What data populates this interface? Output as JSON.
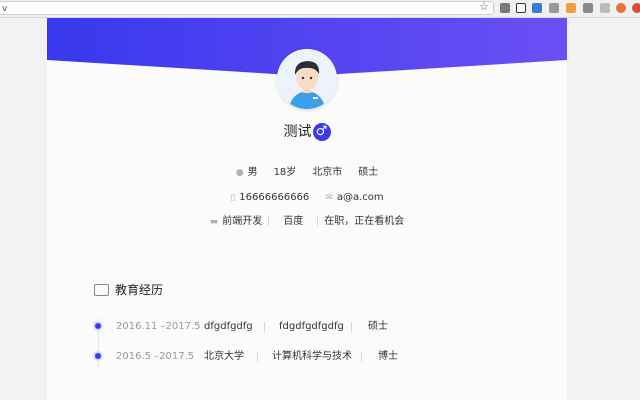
{
  "browser": {
    "url_fragment": "v",
    "colors": {
      "ext_gray": "#7a7a7a",
      "ext_blue": "#3b7bd6",
      "ext_orange": "#f0a040",
      "ext_red": "#e04a3a"
    }
  },
  "theme": {
    "accent": "#3b3be8",
    "header_gradient_start": "#3a3af0",
    "header_gradient_end": "#6a4ff5"
  },
  "profile": {
    "name": "测试",
    "gender_symbol": "♂",
    "gender": "男",
    "age": "18岁",
    "city": "北京市",
    "degree": "硕士",
    "phone": "16666666666",
    "email": "a@a.com",
    "job_title": "前端开发",
    "company": "百度",
    "status": "在职，正在看机会"
  },
  "education": {
    "title": "教育经历",
    "items": [
      {
        "date": "2016.11 –2017.5",
        "school": "dfgdfgdfg",
        "major": "fdgdfgdfgdfg",
        "degree": "硕士"
      },
      {
        "date": "2016.5 –2017.5",
        "school": "北京大学",
        "major": "计算机科学与技术",
        "degree": "博士"
      }
    ]
  }
}
